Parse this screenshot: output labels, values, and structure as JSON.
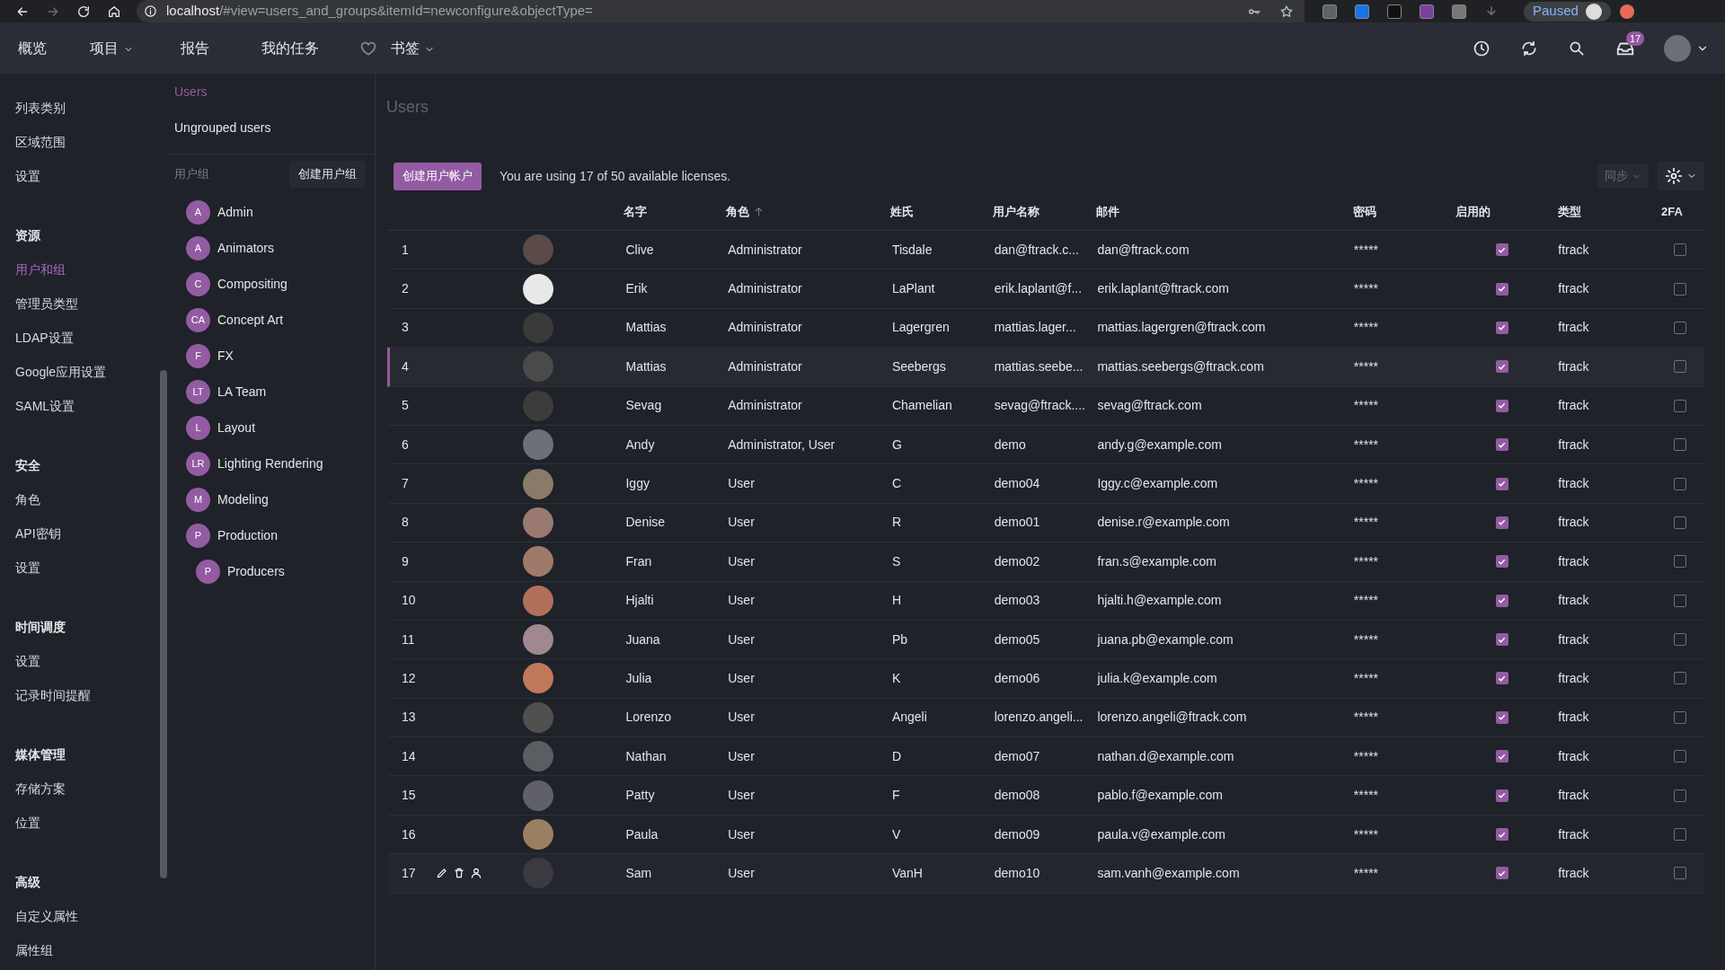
{
  "browser": {
    "url_host": "localhost",
    "url_path": "/#view=users_and_groups&itemId=newconfigure&objectType=",
    "profile_status": "Paused"
  },
  "nav": {
    "items": [
      {
        "label": "概览",
        "dropdown": false
      },
      {
        "label": "项目",
        "dropdown": true
      },
      {
        "label": "报告",
        "dropdown": false
      },
      {
        "label": "我的任务",
        "dropdown": false
      },
      {
        "label": "书签",
        "dropdown": true,
        "heart": true
      }
    ],
    "inbox_badge": "17"
  },
  "sidebar": {
    "sections": [
      {
        "items": [
          {
            "label": "列表类别",
            "selected": false
          },
          {
            "label": "区域范围",
            "selected": false
          },
          {
            "label": "设置",
            "selected": false
          }
        ]
      },
      {
        "header": "资源",
        "items": [
          {
            "label": "用户和组",
            "selected": true
          },
          {
            "label": "管理员类型",
            "selected": false
          },
          {
            "label": "LDAP设置",
            "selected": false
          },
          {
            "label": "Google应用设置",
            "selected": false
          },
          {
            "label": "SAML设置",
            "selected": false
          }
        ]
      },
      {
        "header": "安全",
        "items": [
          {
            "label": "角色",
            "selected": false
          },
          {
            "label": "API密钥",
            "selected": false
          },
          {
            "label": "设置",
            "selected": false
          }
        ]
      },
      {
        "header": "时间调度",
        "items": [
          {
            "label": "设置",
            "selected": false
          },
          {
            "label": "记录时间提醒",
            "selected": false
          }
        ]
      },
      {
        "header": "媒体管理",
        "items": [
          {
            "label": "存储方案",
            "selected": false
          },
          {
            "label": "位置",
            "selected": false
          }
        ]
      },
      {
        "header": "高级",
        "items": [
          {
            "label": "自定义属性",
            "selected": false
          },
          {
            "label": "属性组",
            "selected": false
          }
        ]
      }
    ]
  },
  "groups_panel": {
    "links": [
      {
        "label": "Users",
        "selected": true
      },
      {
        "label": "Ungrouped users",
        "selected": false
      }
    ],
    "groups_label": "用户组",
    "create_button": "创建用户组",
    "groups": [
      {
        "initials": "A",
        "name": "Admin"
      },
      {
        "initials": "A",
        "name": "Animators"
      },
      {
        "initials": "C",
        "name": "Compositing"
      },
      {
        "initials": "CA",
        "name": "Concept Art"
      },
      {
        "initials": "F",
        "name": "FX"
      },
      {
        "initials": "LT",
        "name": "LA Team"
      },
      {
        "initials": "L",
        "name": "Layout"
      },
      {
        "initials": "LR",
        "name": "Lighting Rendering"
      },
      {
        "initials": "M",
        "name": "Modeling"
      },
      {
        "initials": "P",
        "name": "Production",
        "children": [
          {
            "initials": "P",
            "name": "Producers"
          }
        ]
      }
    ]
  },
  "main": {
    "title": "Users",
    "create_button": "创建用户帐户",
    "license_text": "You are using 17 of 50 available licenses.",
    "sync_button": "同步"
  },
  "table": {
    "columns": [
      {
        "label": "名字",
        "sorted": false
      },
      {
        "label": "角色",
        "sorted": true
      },
      {
        "label": "姓氏",
        "sorted": false
      },
      {
        "label": "用户名称",
        "sorted": false
      },
      {
        "label": "邮件",
        "sorted": false
      },
      {
        "label": "密码",
        "sorted": false
      },
      {
        "label": "启用的",
        "sorted": false
      },
      {
        "label": "类型",
        "sorted": false
      },
      {
        "label": "2FA",
        "sorted": false
      }
    ],
    "rows": [
      {
        "number": "1",
        "first_name": "Clive",
        "role": "Administrator",
        "last_name": "Tisdale",
        "username": "dan@ftrack.c...",
        "email": "dan@ftrack.com",
        "password": "*****",
        "enabled": true,
        "type": "ftrack",
        "two_fa": false,
        "selected": false,
        "hovered": false
      },
      {
        "number": "2",
        "first_name": "Erik",
        "role": "Administrator",
        "last_name": "LaPlant",
        "username": "erik.laplant@f...",
        "email": "erik.laplant@ftrack.com",
        "password": "*****",
        "enabled": true,
        "type": "ftrack",
        "two_fa": false,
        "selected": false,
        "hovered": false
      },
      {
        "number": "3",
        "first_name": "Mattias",
        "role": "Administrator",
        "last_name": "Lagergren",
        "username": "mattias.lager...",
        "email": "mattias.lagergren@ftrack.com",
        "password": "*****",
        "enabled": true,
        "type": "ftrack",
        "two_fa": false,
        "selected": false,
        "hovered": false
      },
      {
        "number": "4",
        "first_name": "Mattias",
        "role": "Administrator",
        "last_name": "Seebergs",
        "username": "mattias.seebe...",
        "email": "mattias.seebergs@ftrack.com",
        "password": "*****",
        "enabled": true,
        "type": "ftrack",
        "two_fa": false,
        "selected": true,
        "hovered": false
      },
      {
        "number": "5",
        "first_name": "Sevag",
        "role": "Administrator",
        "last_name": "Chamelian",
        "username": "sevag@ftrack....",
        "email": "sevag@ftrack.com",
        "password": "*****",
        "enabled": true,
        "type": "ftrack",
        "two_fa": false,
        "selected": false,
        "hovered": false
      },
      {
        "number": "6",
        "first_name": "Andy",
        "role": "Administrator, User",
        "last_name": "G",
        "username": "demo",
        "email": "andy.g@example.com",
        "password": "*****",
        "enabled": true,
        "type": "ftrack",
        "two_fa": false,
        "selected": false,
        "hovered": false
      },
      {
        "number": "7",
        "first_name": "Iggy",
        "role": "User",
        "last_name": "C",
        "username": "demo04",
        "email": "Iggy.c@example.com",
        "password": "*****",
        "enabled": true,
        "type": "ftrack",
        "two_fa": false,
        "selected": false,
        "hovered": false
      },
      {
        "number": "8",
        "first_name": "Denise",
        "role": "User",
        "last_name": "R",
        "username": "demo01",
        "email": "denise.r@example.com",
        "password": "*****",
        "enabled": true,
        "type": "ftrack",
        "two_fa": false,
        "selected": false,
        "hovered": false
      },
      {
        "number": "9",
        "first_name": "Fran",
        "role": "User",
        "last_name": "S",
        "username": "demo02",
        "email": "fran.s@example.com",
        "password": "*****",
        "enabled": true,
        "type": "ftrack",
        "two_fa": false,
        "selected": false,
        "hovered": false
      },
      {
        "number": "10",
        "first_name": "Hjalti",
        "role": "User",
        "last_name": "H",
        "username": "demo03",
        "email": "hjalti.h@example.com",
        "password": "*****",
        "enabled": true,
        "type": "ftrack",
        "two_fa": false,
        "selected": false,
        "hovered": false
      },
      {
        "number": "11",
        "first_name": "Juana",
        "role": "User",
        "last_name": "Pb",
        "username": "demo05",
        "email": "juana.pb@example.com",
        "password": "*****",
        "enabled": true,
        "type": "ftrack",
        "two_fa": false,
        "selected": false,
        "hovered": false
      },
      {
        "number": "12",
        "first_name": "Julia",
        "role": "User",
        "last_name": "K",
        "username": "demo06",
        "email": "julia.k@example.com",
        "password": "*****",
        "enabled": true,
        "type": "ftrack",
        "two_fa": false,
        "selected": false,
        "hovered": false
      },
      {
        "number": "13",
        "first_name": "Lorenzo",
        "role": "User",
        "last_name": "Angeli",
        "username": "lorenzo.angeli...",
        "email": "lorenzo.angeli@ftrack.com",
        "password": "*****",
        "enabled": true,
        "type": "ftrack",
        "two_fa": false,
        "selected": false,
        "hovered": false
      },
      {
        "number": "14",
        "first_name": "Nathan",
        "role": "User",
        "last_name": "D",
        "username": "demo07",
        "email": "nathan.d@example.com",
        "password": "*****",
        "enabled": true,
        "type": "ftrack",
        "two_fa": false,
        "selected": false,
        "hovered": false
      },
      {
        "number": "15",
        "first_name": "Patty",
        "role": "User",
        "last_name": "F",
        "username": "demo08",
        "email": "pablo.f@example.com",
        "password": "*****",
        "enabled": true,
        "type": "ftrack",
        "two_fa": false,
        "selected": false,
        "hovered": false
      },
      {
        "number": "16",
        "first_name": "Paula",
        "role": "User",
        "last_name": "V",
        "username": "demo09",
        "email": "paula.v@example.com",
        "password": "*****",
        "enabled": true,
        "type": "ftrack",
        "two_fa": false,
        "selected": false,
        "hovered": false
      },
      {
        "number": "17",
        "first_name": "Sam",
        "role": "User",
        "last_name": "VanH",
        "username": "demo10",
        "email": "sam.vanh@example.com",
        "password": "*****",
        "enabled": true,
        "type": "ftrack",
        "two_fa": false,
        "selected": false,
        "hovered": true
      }
    ]
  }
}
